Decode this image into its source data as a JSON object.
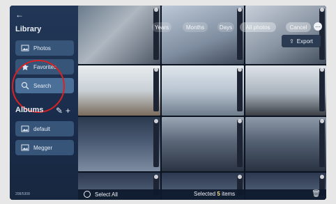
{
  "sidebar": {
    "back_icon": "back-arrow-icon",
    "library_title": "Library",
    "items": [
      {
        "label": "Photos",
        "icon": "image-icon"
      },
      {
        "label": "Favorites",
        "icon": "star-icon"
      },
      {
        "label": "Search",
        "icon": "search-icon"
      }
    ],
    "albums_title": "Albums",
    "album_actions": {
      "edit": "✎",
      "add": "+"
    },
    "albums": [
      {
        "label": "default",
        "icon": "image-icon"
      },
      {
        "label": "Megger",
        "icon": "image-icon"
      }
    ],
    "count_text": "208/5308"
  },
  "top": {
    "tabs": [
      "Years",
      "Months",
      "Days",
      "All photos"
    ],
    "active_tab": "All photos",
    "cancel": "Cancel",
    "more_icon": "ellipsis-icon"
  },
  "export": {
    "label": "Export",
    "icon": "share-icon"
  },
  "bottom": {
    "select_all": "Select All",
    "selected_prefix": "Selected",
    "selected_count": "5",
    "selected_suffix": "items",
    "delete_icon": "trash-icon"
  },
  "colors": {
    "sidebar_bg": "#223757",
    "button_bg": "#365579",
    "highlight_circle": "#d92222"
  }
}
